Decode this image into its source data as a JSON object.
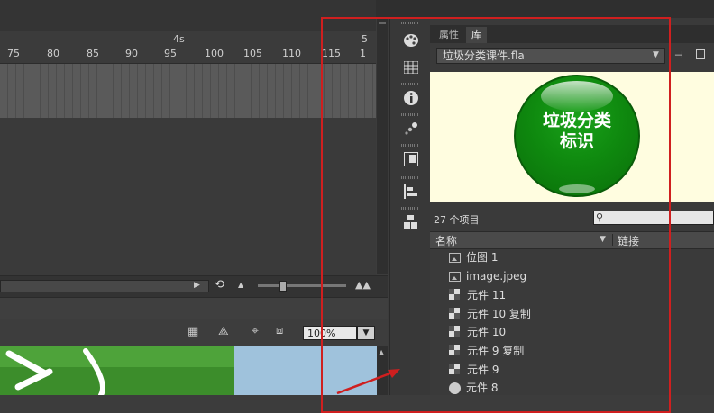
{
  "timeline": {
    "seconds_marker_1": "4s",
    "seconds_marker_2": "5",
    "ruler_labels": [
      "75",
      "80",
      "85",
      "90",
      "95",
      "100",
      "105",
      "110",
      "115",
      "1"
    ]
  },
  "stage": {
    "zoom_value": "100%"
  },
  "library": {
    "tab_properties": "属性",
    "tab_library": "库",
    "file_name": "垃圾分类课件.fla",
    "preview_text_line1": "垃圾分类",
    "preview_text_line2": "标识",
    "item_count": "27 个项目",
    "search_placeholder": "",
    "col_name": "名称",
    "col_linkage": "链接",
    "items": [
      {
        "type": "bitmap",
        "name": "位图 1"
      },
      {
        "type": "bitmap",
        "name": "image.jpeg"
      },
      {
        "type": "symbol",
        "name": "元件 11"
      },
      {
        "type": "symbol",
        "name": "元件 10 复制"
      },
      {
        "type": "symbol",
        "name": "元件 10"
      },
      {
        "type": "symbol",
        "name": "元件 9 复制"
      },
      {
        "type": "symbol",
        "name": "元件 9"
      },
      {
        "type": "button",
        "name": "元件 8"
      }
    ]
  },
  "colors": {
    "annotation_red": "#cf1f1f",
    "preview_bg": "#fffde0",
    "button_green": "#0f8a0f"
  }
}
